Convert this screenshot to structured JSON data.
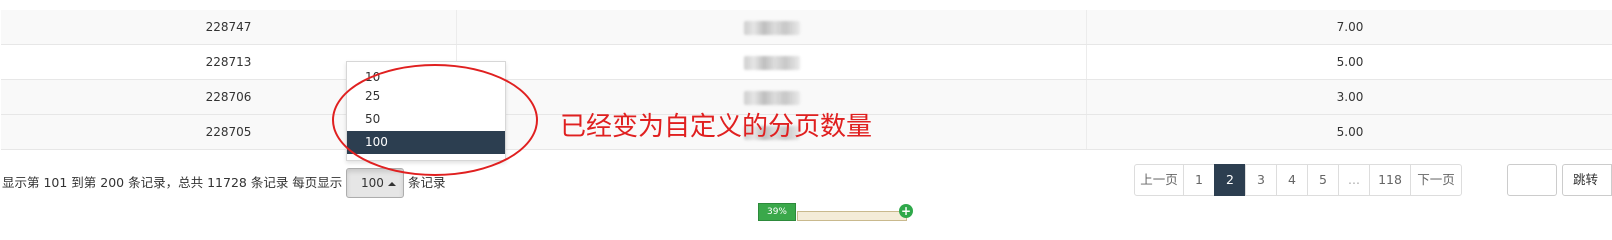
{
  "table": {
    "rows": [
      {
        "id": "228747",
        "amount": "7.00"
      },
      {
        "id": "228713",
        "amount": "5.00"
      },
      {
        "id": "228706",
        "amount": "3.00"
      },
      {
        "id": "228705",
        "amount": "5.00"
      }
    ]
  },
  "page_size_dropdown": {
    "options": [
      "10",
      "25",
      "50",
      "100"
    ],
    "selected": "100"
  },
  "annotation": {
    "text": "已经变为自定义的分页数量",
    "color": "#e02020"
  },
  "footer": {
    "info_prefix": "显示第 101 到第 200 条记录，总共 11728 条记录 每页显示",
    "page_size_value": "100",
    "info_suffix": "条记录"
  },
  "pagination": {
    "prev_label": "上一页",
    "pages": [
      "1",
      "2",
      "3",
      "4",
      "5",
      "...",
      "118"
    ],
    "active_page": "2",
    "next_label": "下一页",
    "jump_label": "跳转"
  },
  "floating_widget": {
    "percent": "39%"
  },
  "colors": {
    "accent": "#2c3e50",
    "row_stripe": "#f9f9f9",
    "annotation_red": "#e02020",
    "widget_green": "#3aa84a"
  }
}
